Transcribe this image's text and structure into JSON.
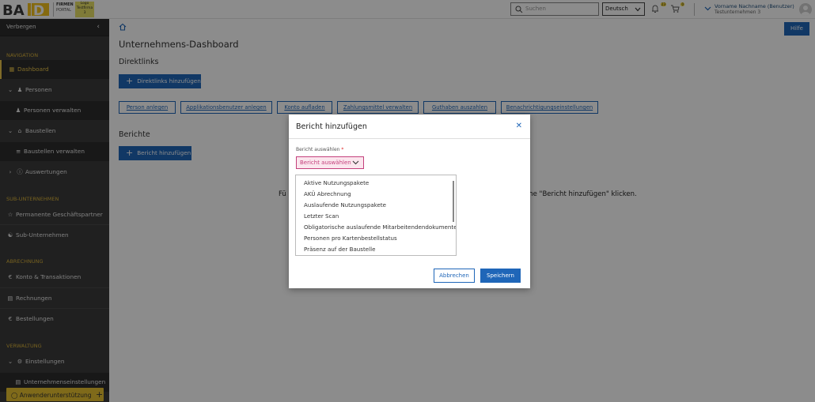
{
  "header": {
    "logo_text": "BAUID",
    "portal_line1": "FIRMEN",
    "portal_line2": "PORTAL",
    "firm_badge_line1": "Logo",
    "firm_badge_line2": "Testfirma",
    "firm_badge_line3": "3",
    "search_placeholder": "Suchen",
    "language": "Deutsch",
    "bell_badge": "23",
    "cart_badge": "0",
    "user_name": "Vorname Nachname (Benutzer)",
    "user_company": "Testunternehmen 3"
  },
  "sidebar": {
    "hide_label": "Verbergen",
    "sections": {
      "navigation": "NAVIGATION",
      "sub": "SUB-UNTERNEHMEN",
      "abrechnung": "ABRECHNUNG",
      "verwaltung": "VERWALTUNG"
    },
    "items": {
      "dashboard": "Dashboard",
      "personen": "Personen",
      "personen_verwalten": "Personen verwalten",
      "baustellen": "Baustellen",
      "baustellen_verwalten": "Baustellen verwalten",
      "auswertungen": "Auswertungen",
      "partner": "Permanente Geschäftspartner",
      "subunternehmen": "Sub-Unternehmen",
      "konto": "Konto & Transaktionen",
      "rechnungen": "Rechnungen",
      "bestellungen": "Bestellungen",
      "einstellungen": "Einstellungen",
      "unternehmenseinstellungen": "Unternehmenseinstellungen"
    },
    "support_label": "Anwenderunterstützung"
  },
  "main": {
    "help_label": "Hilfe",
    "title": "Unternehmens-Dashboard",
    "direktlinks_title": "Direktlinks",
    "add_direktlinks": "Direktlinks hinzufügen",
    "quick_links": [
      "Person anlegen",
      "Applikationsbenutzer anlegen",
      "Konto aufladen",
      "Zahlungsmittel verwalten",
      "Guthaben auszahlen",
      "Benachrichtigungseinstellungen"
    ],
    "berichte_title": "Berichte",
    "add_bericht": "Bericht hinzufügen",
    "hint_left": "Fü",
    "hint_right": "fläche \"Bericht hinzufügen\" klicken."
  },
  "modal": {
    "title": "Bericht hinzufügen",
    "field_label": "Bericht auswählen",
    "required_mark": "*",
    "select_value": "Bericht auswählen",
    "options": [
      "Aktive Nutzungspakete",
      "AKÜ Abrechnung",
      "Auslaufende Nutzungspakete",
      "Letzter Scan",
      "Obligatorische auslaufende Mitarbeitendendokumente",
      "Personen pro Kartenbestellstatus",
      "Präsenz auf der Baustelle"
    ],
    "cancel_label": "Abbrechen",
    "save_label": "Speichern"
  }
}
